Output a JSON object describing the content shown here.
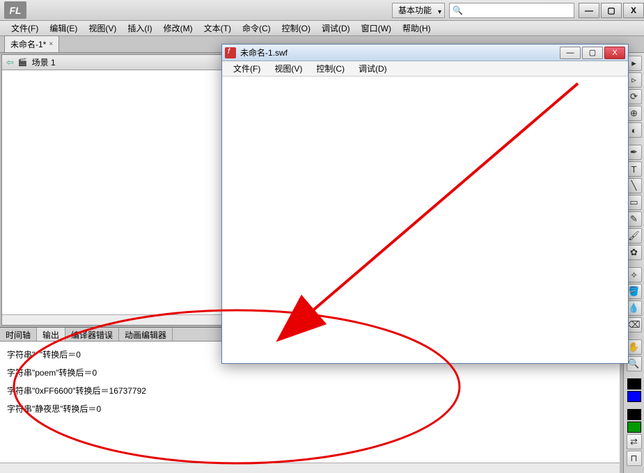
{
  "app": {
    "logo": "FL"
  },
  "workspace": {
    "label": "基本功能"
  },
  "search": {
    "placeholder": ""
  },
  "menu": {
    "items": [
      "文件(F)",
      "编辑(E)",
      "视图(V)",
      "插入(I)",
      "修改(M)",
      "文本(T)",
      "命令(C)",
      "控制(O)",
      "调试(D)",
      "窗口(W)",
      "帮助(H)"
    ]
  },
  "docTab": {
    "label": "未命名-1*",
    "close": "×"
  },
  "stage": {
    "sceneLabel": "场景 1"
  },
  "bottomTabs": {
    "timeline": "时间轴",
    "output": "输出",
    "compilerErrors": "编译器错误",
    "motionEditor": "动画编辑器"
  },
  "output": {
    "lines": [
      "字符串\"  \"转换后＝0",
      "字符串\"poem\"转换后＝0",
      "字符串\"0xFF6600\"转换后＝16737792",
      "字符串\"静夜思\"转换后＝0"
    ]
  },
  "swf": {
    "title": "未命名-1.swf",
    "menu": [
      "文件(F)",
      "视图(V)",
      "控制(C)",
      "调试(D)"
    ]
  },
  "winBtns": {
    "min": "—",
    "max": "▢",
    "close": "X"
  },
  "colors": {
    "black": "#000000",
    "blue": "#0000FF",
    "green": "#009900"
  }
}
